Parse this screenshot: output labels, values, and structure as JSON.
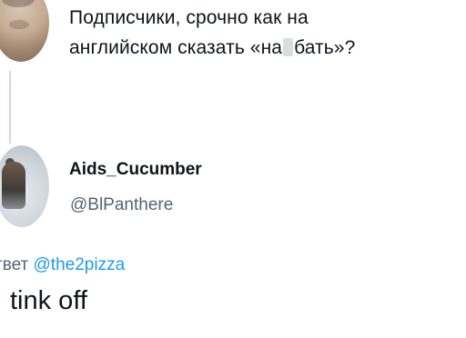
{
  "parent_tweet": {
    "line1": "Подписчики, срочно как на",
    "line2_before": "английском сказать «на",
    "line2_after": "бать»?"
  },
  "reply_tweet": {
    "display_name": "Aids_Cucumber",
    "handle": "@BlPanthere",
    "replying_prefix": "твет",
    "replying_mention": "@the2pizza",
    "text": "tink off"
  },
  "colors": {
    "text": "#0f1419",
    "secondary": "#536471",
    "link": "#1d9bf0",
    "thread_line": "#cfd9de"
  }
}
